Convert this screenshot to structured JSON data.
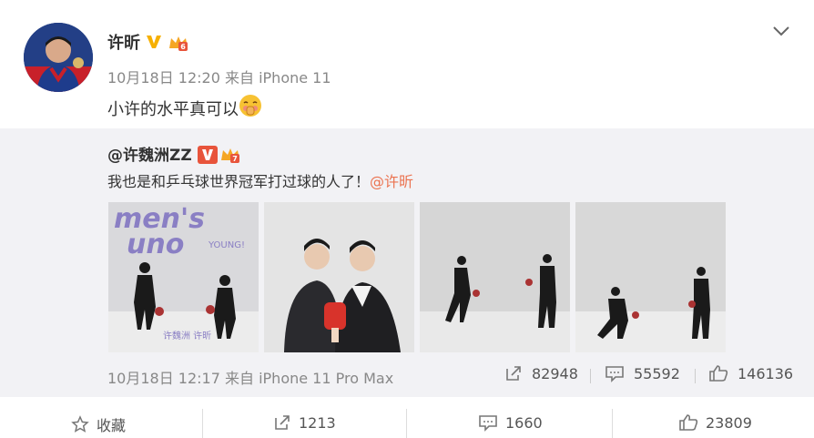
{
  "post": {
    "author": "许昕",
    "meta": "10月18日 12:20 来自 iPhone 11",
    "text": "小许的水平真可以"
  },
  "repost": {
    "author": "@许魏洲ZZ",
    "text": "我也是和乒乓球世界冠军打过球的人了！",
    "mention": "@许昕",
    "meta": "10月18日 12:17 来自 iPhone 11 Pro Max",
    "cover_title_1": "men's",
    "cover_title_2": "uno",
    "cover_sub": "YOUNG!",
    "cover_names": "许魏洲 许昕",
    "stats": {
      "repost": "82948",
      "comment": "55592",
      "like": "146136"
    }
  },
  "actions": {
    "favorite": "收藏",
    "repost": "1213",
    "comment": "1660",
    "like": "23809"
  },
  "colors": {
    "accent": "#eb7350",
    "verified": "#f6b000",
    "repost_bg": "#f2f2f5"
  }
}
